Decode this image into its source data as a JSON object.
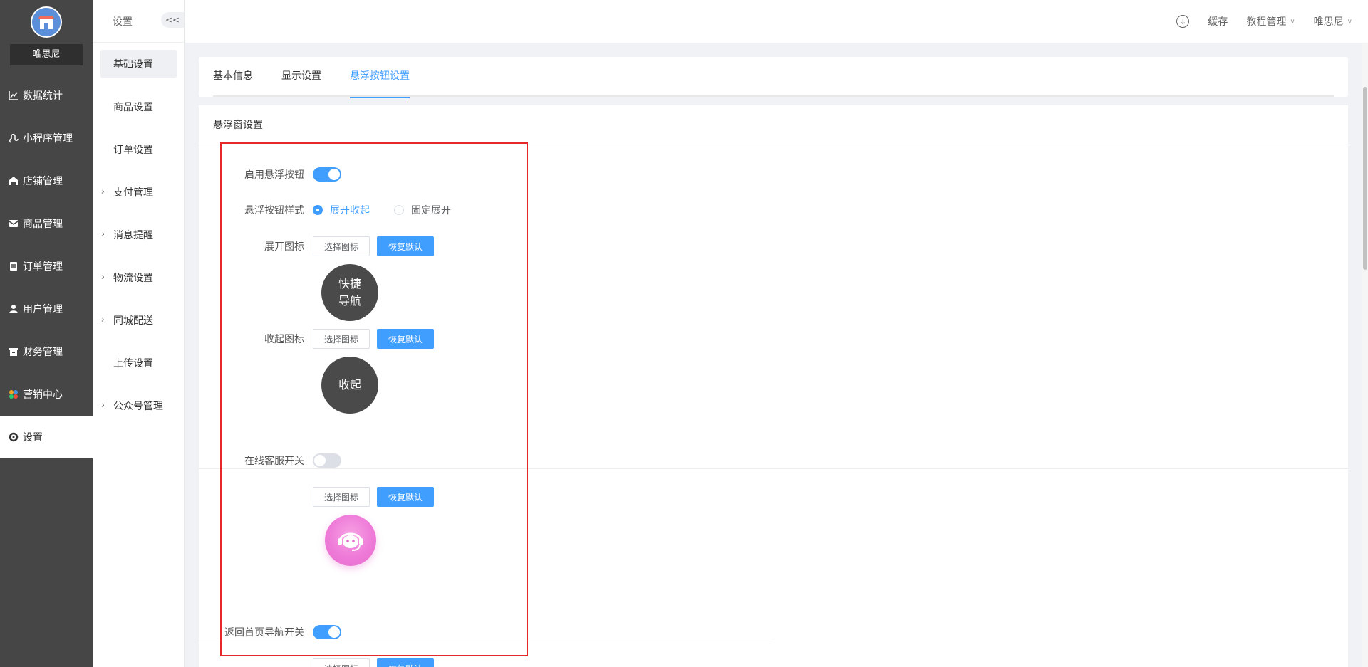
{
  "app": {
    "shop_name": "唯思尼"
  },
  "sidebar": {
    "items": [
      {
        "label": "数据统计",
        "icon": "chart-line-icon"
      },
      {
        "label": "小程序管理",
        "icon": "miniprogram-icon"
      },
      {
        "label": "店铺管理",
        "icon": "store-icon"
      },
      {
        "label": "商品管理",
        "icon": "goods-icon"
      },
      {
        "label": "订单管理",
        "icon": "order-icon"
      },
      {
        "label": "用户管理",
        "icon": "user-icon"
      },
      {
        "label": "财务管理",
        "icon": "finance-icon"
      },
      {
        "label": "营销中心",
        "icon": "marketing-icon"
      },
      {
        "label": "设置",
        "icon": "settings-icon",
        "active": true
      }
    ]
  },
  "submenu": {
    "title": "设置",
    "collapse_label": "<<",
    "items": [
      {
        "label": "基础设置",
        "active": true,
        "expandable": false
      },
      {
        "label": "商品设置",
        "expandable": false
      },
      {
        "label": "订单设置",
        "expandable": false
      },
      {
        "label": "支付管理",
        "expandable": true
      },
      {
        "label": "消息提醒",
        "expandable": true
      },
      {
        "label": "物流设置",
        "expandable": true
      },
      {
        "label": "同城配送",
        "expandable": true
      },
      {
        "label": "上传设置",
        "expandable": false
      },
      {
        "label": "公众号管理",
        "expandable": true
      }
    ]
  },
  "topbar": {
    "cache_label": "缓存",
    "tutorial_label": "教程管理",
    "user_label": "唯思尼"
  },
  "tabs": [
    {
      "label": "基本信息"
    },
    {
      "label": "显示设置"
    },
    {
      "label": "悬浮按钮设置",
      "active": true
    }
  ],
  "section_title": "悬浮窗设置",
  "form": {
    "enable_float": {
      "label": "启用悬浮按钮",
      "on": true
    },
    "float_style": {
      "label": "悬浮按钮样式",
      "options": [
        {
          "label": "展开收起",
          "checked": true
        },
        {
          "label": "固定展开",
          "checked": false
        }
      ]
    },
    "expand_icon": {
      "label": "展开图标",
      "preview_text": "快捷导航"
    },
    "collapse_icon": {
      "label": "收起图标",
      "preview_text": "收起"
    },
    "customer_service": {
      "label": "在线客服开关",
      "on": false
    },
    "back_home": {
      "label": "返回首页导航开关",
      "on": true
    },
    "select_icon_label": "选择图标",
    "restore_default_label": "恢复默认"
  },
  "colors": {
    "primary": "#409eff",
    "sidebar_bg": "#464646",
    "highlight_border": "#e52828",
    "icon_dark": "#4a4a4a",
    "cs_pink": "#ee7ad8"
  }
}
